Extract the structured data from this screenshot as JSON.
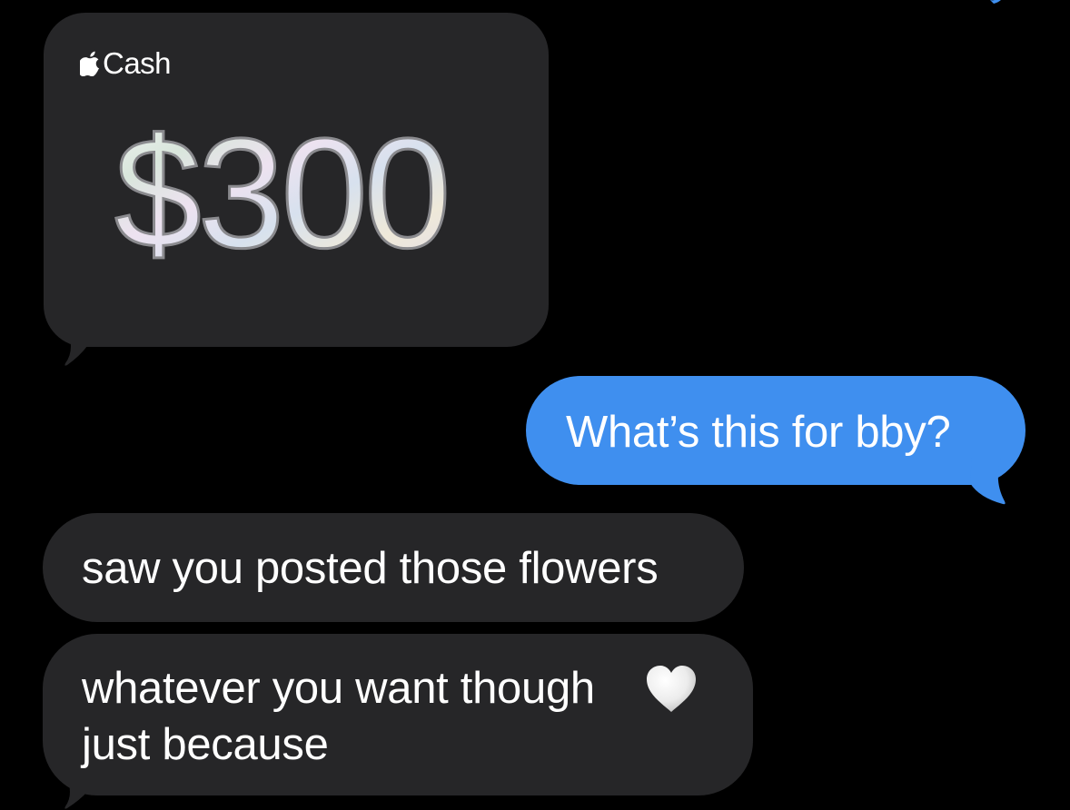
{
  "messages": {
    "cash": {
      "brand_label": "Cash",
      "amount": "$300",
      "icon": "apple-logo-icon"
    },
    "sent_1": {
      "text": "What’s this for bby?"
    },
    "received_1": {
      "text": "saw you posted those flowers"
    },
    "received_2": {
      "line_1": "whatever you want though",
      "line_2": "just because",
      "emoji": "white-heart-icon"
    }
  },
  "colors": {
    "background": "#000000",
    "received_bubble": "#262628",
    "sent_bubble": "#3f8fef",
    "text": "#ffffff"
  }
}
